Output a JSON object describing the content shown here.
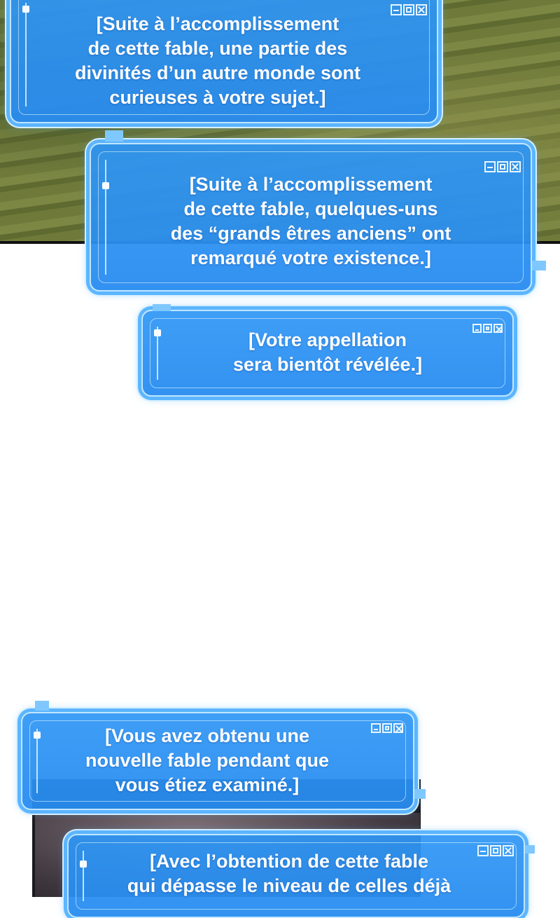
{
  "windows": [
    {
      "text": "[Suite à l’accomplissement\nde cette fable, une partie des\ndivinités d’un autre monde sont\ncurieuses à votre sujet.]"
    },
    {
      "text": "[Suite à l’accomplissement\nde cette fable, quelques-uns\ndes “grands êtres anciens” ont\nremarqué votre existence.]"
    },
    {
      "text": "[Votre appellation\nsera bientôt révélée.]"
    },
    {
      "text": "[Vous avez obtenu une\nnouvelle fable pendant que\nvous étiez examiné.]"
    },
    {
      "text": "[Avec l’obtention de cette fable\nqui dépasse le niveau de celles déjà"
    }
  ],
  "icons": {
    "minimize": "minimize-icon",
    "maximize": "maximize-icon",
    "close": "close-icon"
  },
  "colors": {
    "window_fill": "#2e96f5",
    "window_border": "#bfe6ff",
    "text": "#ffffff"
  }
}
